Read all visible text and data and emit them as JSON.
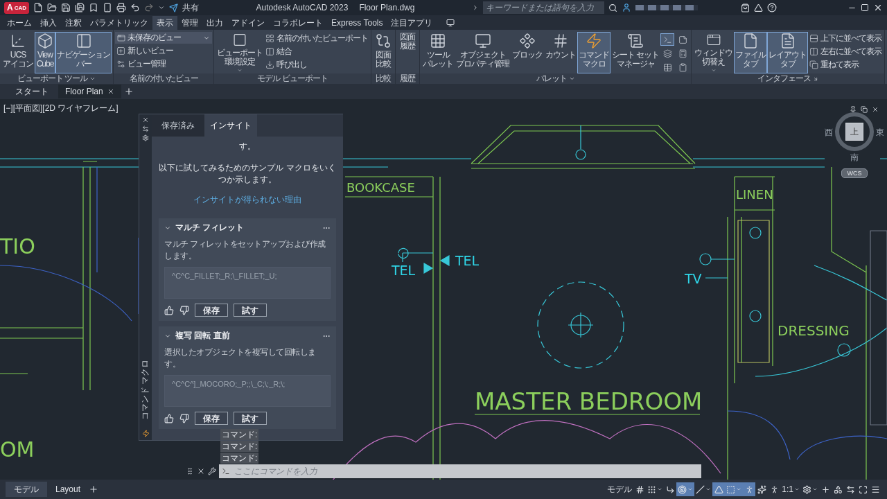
{
  "title_bar": {
    "logo_letter": "A",
    "app_label": "CAD",
    "share": "共有",
    "app_title": "Autodesk AutoCAD 2023",
    "file_name": "Floor Plan.dwg",
    "search": {
      "placeholder": "キーワードまたは語句を入力"
    }
  },
  "menu_tabs": [
    {
      "label": "ホーム",
      "selected": false
    },
    {
      "label": "挿入",
      "selected": false
    },
    {
      "label": "注釈",
      "selected": false
    },
    {
      "label": "パラメトリック",
      "selected": false
    },
    {
      "label": "表示",
      "selected": true
    },
    {
      "label": "管理",
      "selected": false
    },
    {
      "label": "出力",
      "selected": false
    },
    {
      "label": "アドイン",
      "selected": false
    },
    {
      "label": "コラボレート",
      "selected": false
    },
    {
      "label": "Express Tools",
      "selected": false
    },
    {
      "label": "注目アプリ",
      "selected": false
    }
  ],
  "ribbon": [
    {
      "title": "ビューポート ツール",
      "menu": true,
      "items": [
        {
          "kind": "large",
          "lines": [
            "UCS",
            "アイコン"
          ],
          "on": false
        },
        {
          "kind": "large",
          "lines": [
            "View",
            "Cube"
          ],
          "on": true
        },
        {
          "kind": "large",
          "lines": [
            "ナビゲーション",
            "バー"
          ],
          "on": true
        }
      ]
    },
    {
      "title": "名前の付いたビュー",
      "items": [
        {
          "kind": "combo",
          "label": "未保存のビュー"
        },
        {
          "kind": "small",
          "label": "新しいビュー"
        },
        {
          "kind": "small",
          "label": "ビュー管理"
        }
      ]
    },
    {
      "title": "モデル ビューポート",
      "items": [
        {
          "kind": "large",
          "lines": [
            "ビューポート",
            "環境設定"
          ],
          "on": false,
          "dropdown": true
        },
        {
          "kind": "small",
          "label": "名前の付いたビューポート"
        },
        {
          "kind": "small",
          "label": "結合"
        },
        {
          "kind": "small",
          "label": "呼び出し"
        }
      ]
    },
    {
      "title": "比較",
      "items": [
        {
          "kind": "large",
          "lines": [
            "図面",
            "比較"
          ],
          "on": false
        }
      ]
    },
    {
      "title": "履歴",
      "items": [
        {
          "kind": "large",
          "lines": [
            "図面",
            "履歴"
          ],
          "on": false
        }
      ]
    },
    {
      "title": "パレット",
      "menu": true,
      "items": [
        {
          "kind": "large",
          "lines": [
            "ツール",
            "パレット"
          ],
          "on": false
        },
        {
          "kind": "large",
          "lines": [
            "オブジェクト",
            "プロパティ管理"
          ],
          "on": false
        },
        {
          "kind": "large",
          "lines": [
            "ブロック"
          ],
          "on": false
        },
        {
          "kind": "large",
          "lines": [
            "カウント"
          ],
          "on": false
        },
        {
          "kind": "large",
          "lines": [
            "コマンド",
            "マクロ"
          ],
          "on": true
        },
        {
          "kind": "large",
          "lines": [
            "シート セット",
            "マネージャ"
          ],
          "on": false
        },
        {
          "kind": "icon",
          "on": true
        },
        {
          "kind": "icon",
          "on": false
        },
        {
          "kind": "icon",
          "on": false
        },
        {
          "kind": "icon",
          "on": false
        },
        {
          "kind": "icon",
          "on": false
        },
        {
          "kind": "icon",
          "on": false
        }
      ]
    },
    {
      "title": "インタフェース",
      "launcher": true,
      "items": [
        {
          "kind": "large",
          "lines": [
            "ウィンドウ",
            "切替え"
          ],
          "on": false,
          "dropdown": true
        },
        {
          "kind": "large",
          "lines": [
            "ファイル",
            "タブ"
          ],
          "on": true
        },
        {
          "kind": "large",
          "lines": [
            "レイアウト",
            "タブ"
          ],
          "on": true
        },
        {
          "kind": "small",
          "label": "上下に並べて表示"
        },
        {
          "kind": "small",
          "label": "左右に並べて表示"
        },
        {
          "kind": "small",
          "label": "重ねて表示"
        }
      ]
    }
  ],
  "doc_tabs": [
    {
      "label": "スタート",
      "selected": false
    },
    {
      "label": "Floor Plan",
      "selected": true,
      "closable": true
    }
  ],
  "viewport": {
    "label": "[−][平面図][2D ワイヤフレーム]",
    "room_labels": [
      {
        "text": "TIO",
        "color": "#8ccf5c"
      },
      {
        "text": "BOOKCASE",
        "color": "#8ccf5c"
      },
      {
        "text": "LINEN",
        "color": "#8ccf5c"
      },
      {
        "text": "TEL",
        "color": "#2fd6e8"
      },
      {
        "text": "TEL",
        "color": "#2fd6e8"
      },
      {
        "text": "TV",
        "color": "#2fd6e8"
      },
      {
        "text": "DRESSING",
        "color": "#8ccf5c"
      },
      {
        "text": "MASTER BEDROOM",
        "color": "#8ccf5c"
      },
      {
        "text": "OM",
        "color": "#8ccf5c"
      }
    ],
    "viewcube": {
      "top": "上",
      "west": "西",
      "east": "東",
      "south": "南",
      "wcs": "WCS"
    }
  },
  "palette": {
    "side_title": "コマンド マクロ",
    "tabs": [
      {
        "label": "保存済み",
        "selected": false
      },
      {
        "label": "インサイト",
        "selected": true
      }
    ],
    "intro_tail": "す。",
    "intro": "以下に試してみるためのサンプル マクロをいくつか示します。",
    "link": "インサイトが得られない理由",
    "macros": [
      {
        "title": "マルチ フィレット",
        "expanded": true,
        "description": "マルチ フィレットをセットアップおよび作成します。",
        "macro": "^C^C_FILLET;_R;\\_FILLET;_U;",
        "save": "保存",
        "try": "試す"
      },
      {
        "title": "複写 回転 直前",
        "expanded": true,
        "description": "選択したオブジェクトを複写して回転します。",
        "macro": "^C^C^]_MOCORO;_P;;\\_C;\\;_R;\\;",
        "save": "保存",
        "try": "試す"
      }
    ]
  },
  "command": {
    "history": [
      "コマンド:",
      "コマンド:",
      "コマンド:"
    ],
    "input": {
      "placeholder": "ここにコマンドを入力"
    }
  },
  "layout_tabs": [
    {
      "label": "モデル",
      "selected": true
    },
    {
      "label": "Layout",
      "selected": false
    }
  ],
  "status_bar": [
    {
      "kind": "text",
      "label": "モデル"
    },
    {
      "kind": "icon",
      "on": false
    },
    {
      "kind": "icon",
      "on": false,
      "dropdown": true
    },
    {
      "kind": "icon",
      "on": false
    },
    {
      "kind": "icon",
      "on": true,
      "dropdown": true
    },
    {
      "kind": "icon",
      "on": false,
      "dropdown": true
    },
    {
      "kind": "icon",
      "on": true
    },
    {
      "kind": "icon",
      "on": true,
      "dropdown": true
    },
    {
      "kind": "icon",
      "on": true
    },
    {
      "kind": "icon",
      "on": false
    },
    {
      "kind": "icon",
      "on": false
    },
    {
      "kind": "text",
      "label": "1:1",
      "dropdown": true
    },
    {
      "kind": "icon",
      "on": false,
      "dropdown": true
    },
    {
      "kind": "icon",
      "on": false
    },
    {
      "kind": "icon",
      "on": false
    },
    {
      "kind": "icon",
      "on": false
    },
    {
      "kind": "icon",
      "on": false
    },
    {
      "kind": "icon",
      "on": false
    }
  ]
}
